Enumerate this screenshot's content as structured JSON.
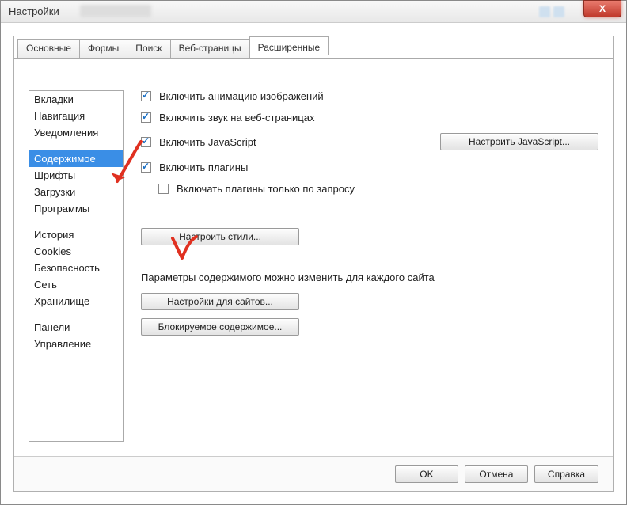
{
  "window": {
    "title": "Настройки",
    "close_label": "X"
  },
  "tabs": [
    {
      "label": "Основные"
    },
    {
      "label": "Формы"
    },
    {
      "label": "Поиск"
    },
    {
      "label": "Веб-страницы"
    },
    {
      "label": "Расширенные"
    }
  ],
  "tabs_active_index": 4,
  "sidebar": {
    "groups": [
      [
        "Вкладки",
        "Навигация",
        "Уведомления"
      ],
      [
        "Содержимое",
        "Шрифты",
        "Загрузки",
        "Программы"
      ],
      [
        "История",
        "Cookies",
        "Безопасность",
        "Сеть",
        "Хранилище"
      ],
      [
        "Панели",
        "Управление"
      ]
    ],
    "selected": "Содержимое"
  },
  "main": {
    "checks": {
      "anim": {
        "label": "Включить анимацию изображений",
        "checked": true
      },
      "sound": {
        "label": "Включить звук на веб-страницах",
        "checked": true
      },
      "js": {
        "label": "Включить JavaScript",
        "checked": true
      },
      "plugins": {
        "label": "Включить плагины",
        "checked": true
      },
      "plugins_ondemand": {
        "label": "Включать плагины только по запросу",
        "checked": false
      }
    },
    "buttons": {
      "js_config": "Настроить JavaScript...",
      "styles": "Настроить стили...",
      "site_settings": "Настройки для сайтов...",
      "blocked": "Блокируемое содержимое..."
    },
    "desc": "Параметры содержимого можно изменить для каждого сайта"
  },
  "footer": {
    "ok": "OK",
    "cancel": "Отмена",
    "help": "Справка"
  }
}
